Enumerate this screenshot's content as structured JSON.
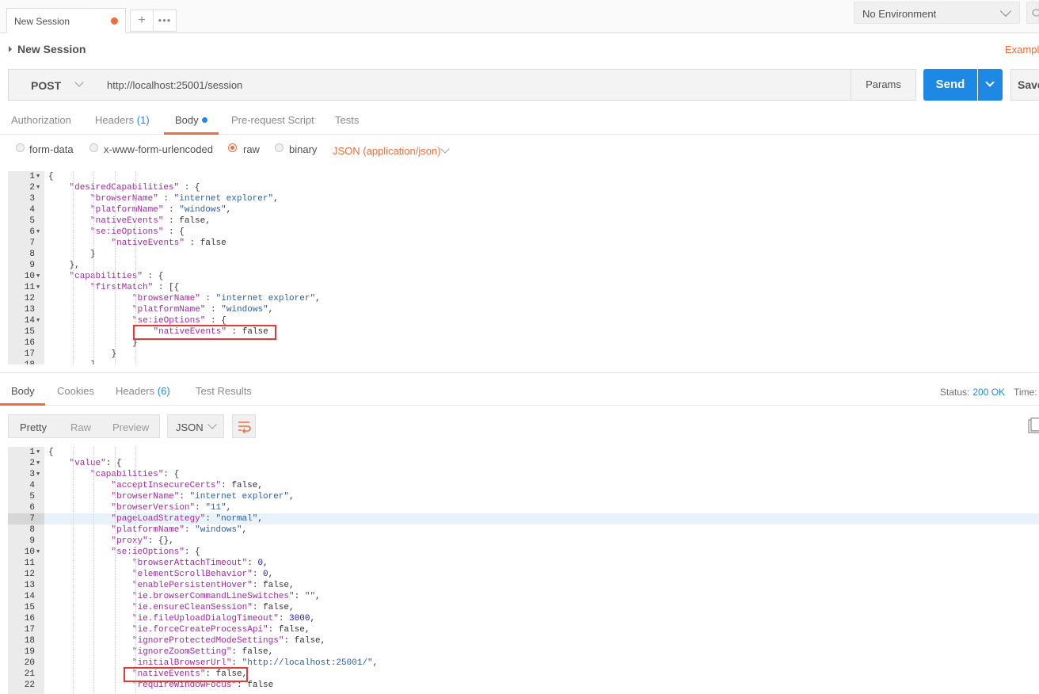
{
  "tabbar": {
    "tab_label": "New Session",
    "add_label": "+",
    "more_label": "•••",
    "environment": "No Environment"
  },
  "request": {
    "name": "New Session",
    "examples_label": "Examples",
    "method": "POST",
    "url": "http://localhost:25001/session",
    "params_label": "Params",
    "send_label": "Send",
    "save_label": "Save"
  },
  "request_tabs": {
    "authorization": "Authorization",
    "headers": "Headers",
    "headers_count": "(1)",
    "body": "Body",
    "prerequest": "Pre-request Script",
    "tests": "Tests"
  },
  "body_types": {
    "form_data": "form-data",
    "urlencoded": "x-www-form-urlencoded",
    "raw": "raw",
    "binary": "binary",
    "content_type": "JSON (application/json)"
  },
  "request_body": [
    {
      "n": "1",
      "fold": true,
      "indent": 0,
      "parts": [
        [
          "p",
          "{"
        ]
      ]
    },
    {
      "n": "2",
      "fold": true,
      "indent": 1,
      "parts": [
        [
          "k",
          "\"desiredCapabilities\""
        ],
        [
          "p",
          " : {"
        ]
      ]
    },
    {
      "n": "3",
      "fold": false,
      "indent": 2,
      "parts": [
        [
          "k",
          "\"browserName\""
        ],
        [
          "p",
          " : "
        ],
        [
          "s",
          "\"internet explorer\""
        ],
        [
          "p",
          ","
        ]
      ]
    },
    {
      "n": "4",
      "fold": false,
      "indent": 2,
      "parts": [
        [
          "k",
          "\"platformName\""
        ],
        [
          "p",
          " : "
        ],
        [
          "s",
          "\"windows\""
        ],
        [
          "p",
          ","
        ]
      ]
    },
    {
      "n": "5",
      "fold": false,
      "indent": 2,
      "parts": [
        [
          "k",
          "\"nativeEvents\""
        ],
        [
          "p",
          " : false,"
        ]
      ]
    },
    {
      "n": "6",
      "fold": true,
      "indent": 2,
      "parts": [
        [
          "k",
          "\"se:ieOptions\""
        ],
        [
          "p",
          " : {"
        ]
      ]
    },
    {
      "n": "7",
      "fold": false,
      "indent": 3,
      "parts": [
        [
          "k",
          "\"nativeEvents\""
        ],
        [
          "p",
          " : false"
        ]
      ]
    },
    {
      "n": "8",
      "fold": false,
      "indent": 2,
      "parts": [
        [
          "p",
          "}"
        ]
      ]
    },
    {
      "n": "9",
      "fold": false,
      "indent": 1,
      "parts": [
        [
          "p",
          "},"
        ]
      ]
    },
    {
      "n": "10",
      "fold": true,
      "indent": 1,
      "parts": [
        [
          "k",
          "\"capabilities\""
        ],
        [
          "p",
          " : {"
        ]
      ]
    },
    {
      "n": "11",
      "fold": true,
      "indent": 2,
      "parts": [
        [
          "k",
          "\"firstMatch\""
        ],
        [
          "p",
          " : [{"
        ]
      ]
    },
    {
      "n": "12",
      "fold": false,
      "indent": 4,
      "parts": [
        [
          "k",
          "\"browserName\""
        ],
        [
          "p",
          " : "
        ],
        [
          "s",
          "\"internet explorer\""
        ],
        [
          "p",
          ","
        ]
      ]
    },
    {
      "n": "13",
      "fold": false,
      "indent": 4,
      "parts": [
        [
          "k",
          "\"platformName\""
        ],
        [
          "p",
          " : "
        ],
        [
          "s",
          "\"windows\""
        ],
        [
          "p",
          ","
        ]
      ]
    },
    {
      "n": "14",
      "fold": true,
      "indent": 4,
      "parts": [
        [
          "k",
          "\"se:ieOptions\""
        ],
        [
          "p",
          " : {"
        ]
      ]
    },
    {
      "n": "15",
      "fold": false,
      "indent": 5,
      "parts": [
        [
          "k",
          "\"nativeEvents\""
        ],
        [
          "p",
          " : false"
        ]
      ]
    },
    {
      "n": "16",
      "fold": false,
      "indent": 4,
      "parts": [
        [
          "p",
          "}"
        ]
      ]
    },
    {
      "n": "17",
      "fold": false,
      "indent": 3,
      "parts": [
        [
          "p",
          "}"
        ]
      ]
    },
    {
      "n": "18",
      "fold": false,
      "indent": 2,
      "parts": [
        [
          "p",
          "]"
        ]
      ]
    }
  ],
  "response_tabs": {
    "body": "Body",
    "cookies": "Cookies",
    "headers": "Headers",
    "headers_count": "(6)",
    "test_results": "Test Results",
    "status_label": "Status:",
    "status_value": "200 OK",
    "time_label": "Time:"
  },
  "response_view": {
    "pretty": "Pretty",
    "raw": "Raw",
    "preview": "Preview",
    "format": "JSON"
  },
  "response_body": [
    {
      "n": "1",
      "fold": true,
      "indent": 0,
      "parts": [
        [
          "p",
          "{"
        ]
      ]
    },
    {
      "n": "2",
      "fold": true,
      "indent": 1,
      "parts": [
        [
          "k",
          "\"value\""
        ],
        [
          "p",
          ": {"
        ]
      ]
    },
    {
      "n": "3",
      "fold": true,
      "indent": 2,
      "parts": [
        [
          "k",
          "\"capabilities\""
        ],
        [
          "p",
          ": {"
        ]
      ]
    },
    {
      "n": "4",
      "fold": false,
      "indent": 3,
      "parts": [
        [
          "k",
          "\"acceptInsecureCerts\""
        ],
        [
          "p",
          ": false,"
        ]
      ]
    },
    {
      "n": "5",
      "fold": false,
      "indent": 3,
      "parts": [
        [
          "k",
          "\"browserName\""
        ],
        [
          "p",
          ": "
        ],
        [
          "s",
          "\"internet explorer\""
        ],
        [
          "p",
          ","
        ]
      ]
    },
    {
      "n": "6",
      "fold": false,
      "indent": 3,
      "parts": [
        [
          "k",
          "\"browserVersion\""
        ],
        [
          "p",
          ": "
        ],
        [
          "s",
          "\"11\""
        ],
        [
          "p",
          ","
        ]
      ]
    },
    {
      "n": "7",
      "fold": false,
      "indent": 3,
      "hl": true,
      "parts": [
        [
          "k",
          "\"pageLoadStrategy\""
        ],
        [
          "p",
          ": "
        ],
        [
          "s",
          "\"normal\""
        ],
        [
          "p",
          ","
        ]
      ]
    },
    {
      "n": "8",
      "fold": false,
      "indent": 3,
      "parts": [
        [
          "k",
          "\"platformName\""
        ],
        [
          "p",
          ": "
        ],
        [
          "s",
          "\"windows\""
        ],
        [
          "p",
          ","
        ]
      ]
    },
    {
      "n": "9",
      "fold": false,
      "indent": 3,
      "parts": [
        [
          "k",
          "\"proxy\""
        ],
        [
          "p",
          ": {},"
        ]
      ]
    },
    {
      "n": "10",
      "fold": true,
      "indent": 3,
      "parts": [
        [
          "k",
          "\"se:ieOptions\""
        ],
        [
          "p",
          ": {"
        ]
      ]
    },
    {
      "n": "11",
      "fold": false,
      "indent": 4,
      "parts": [
        [
          "k",
          "\"browserAttachTimeout\""
        ],
        [
          "p",
          ": "
        ],
        [
          "n",
          "0"
        ],
        [
          "p",
          ","
        ]
      ]
    },
    {
      "n": "12",
      "fold": false,
      "indent": 4,
      "parts": [
        [
          "k",
          "\"elementScrollBehavior\""
        ],
        [
          "p",
          ": "
        ],
        [
          "n",
          "0"
        ],
        [
          "p",
          ","
        ]
      ]
    },
    {
      "n": "13",
      "fold": false,
      "indent": 4,
      "parts": [
        [
          "k",
          "\"enablePersistentHover\""
        ],
        [
          "p",
          ": false,"
        ]
      ]
    },
    {
      "n": "14",
      "fold": false,
      "indent": 4,
      "parts": [
        [
          "k",
          "\"ie.browserCommandLineSwitches\""
        ],
        [
          "p",
          ": "
        ],
        [
          "s",
          "\"\""
        ],
        [
          "p",
          ","
        ]
      ]
    },
    {
      "n": "15",
      "fold": false,
      "indent": 4,
      "parts": [
        [
          "k",
          "\"ie.ensureCleanSession\""
        ],
        [
          "p",
          ": false,"
        ]
      ]
    },
    {
      "n": "16",
      "fold": false,
      "indent": 4,
      "parts": [
        [
          "k",
          "\"ie.fileUploadDialogTimeout\""
        ],
        [
          "p",
          ": "
        ],
        [
          "n",
          "3000"
        ],
        [
          "p",
          ","
        ]
      ]
    },
    {
      "n": "17",
      "fold": false,
      "indent": 4,
      "parts": [
        [
          "k",
          "\"ie.forceCreateProcessApi\""
        ],
        [
          "p",
          ": false,"
        ]
      ]
    },
    {
      "n": "18",
      "fold": false,
      "indent": 4,
      "parts": [
        [
          "k",
          "\"ignoreProtectedModeSettings\""
        ],
        [
          "p",
          ": false,"
        ]
      ]
    },
    {
      "n": "19",
      "fold": false,
      "indent": 4,
      "parts": [
        [
          "k",
          "\"ignoreZoomSetting\""
        ],
        [
          "p",
          ": false,"
        ]
      ]
    },
    {
      "n": "20",
      "fold": false,
      "indent": 4,
      "parts": [
        [
          "k",
          "\"initialBrowserUrl\""
        ],
        [
          "p",
          ": "
        ],
        [
          "s",
          "\"http://localhost:25001/\""
        ],
        [
          "p",
          ","
        ]
      ]
    },
    {
      "n": "21",
      "fold": false,
      "indent": 4,
      "parts": [
        [
          "k",
          "\"nativeEvents\""
        ],
        [
          "p",
          ": false,"
        ]
      ]
    },
    {
      "n": "22",
      "fold": false,
      "indent": 4,
      "parts": [
        [
          "k",
          "\"requireWindowFocus\""
        ],
        [
          "p",
          ": false"
        ]
      ]
    }
  ],
  "colors": {
    "accent_orange": "#f26b3a",
    "send_blue": "#1e88e5",
    "highlight_red": "#e53935"
  }
}
